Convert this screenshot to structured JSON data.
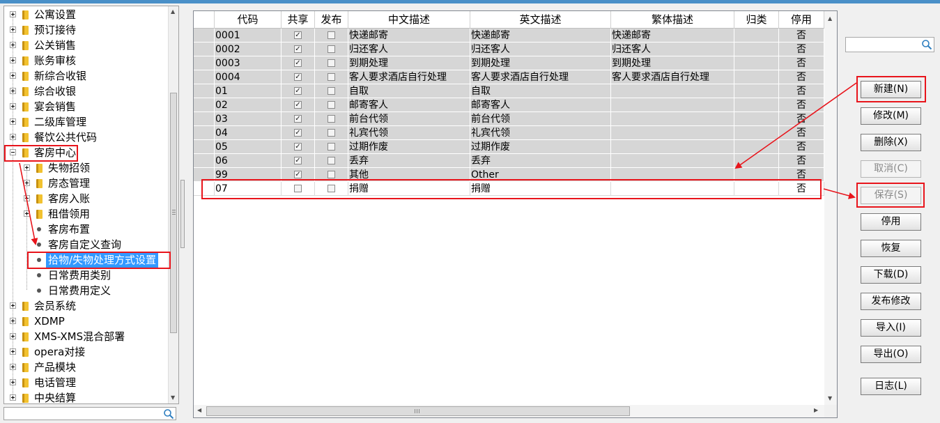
{
  "tree": {
    "items": [
      {
        "label": "公寓设置",
        "level": 0,
        "kind": "folder",
        "expander": "plus"
      },
      {
        "label": "预订接待",
        "level": 0,
        "kind": "folder",
        "expander": "plus"
      },
      {
        "label": "公关销售",
        "level": 0,
        "kind": "folder",
        "expander": "plus"
      },
      {
        "label": "账务审核",
        "level": 0,
        "kind": "folder",
        "expander": "plus"
      },
      {
        "label": "新综合收银",
        "level": 0,
        "kind": "folder",
        "expander": "plus"
      },
      {
        "label": "综合收银",
        "level": 0,
        "kind": "folder",
        "expander": "plus"
      },
      {
        "label": "宴会销售",
        "level": 0,
        "kind": "folder",
        "expander": "plus"
      },
      {
        "label": "二级库管理",
        "level": 0,
        "kind": "folder",
        "expander": "plus"
      },
      {
        "label": "餐饮公共代码",
        "level": 0,
        "kind": "folder",
        "expander": "plus"
      },
      {
        "label": "客房中心",
        "level": 0,
        "kind": "folder",
        "expander": "minus"
      },
      {
        "label": "失物招领",
        "level": 1,
        "kind": "folder",
        "expander": "plus"
      },
      {
        "label": "房态管理",
        "level": 1,
        "kind": "folder",
        "expander": "plus"
      },
      {
        "label": "客房入账",
        "level": 1,
        "kind": "folder",
        "expander": "plus"
      },
      {
        "label": "租借领用",
        "level": 1,
        "kind": "folder",
        "expander": "plus"
      },
      {
        "label": "客房布置",
        "level": 1,
        "kind": "leaf"
      },
      {
        "label": "客房自定义查询",
        "level": 1,
        "kind": "leaf"
      },
      {
        "label": "拾物/失物处理方式设置",
        "level": 1,
        "kind": "leaf",
        "selected": true
      },
      {
        "label": "日常费用类别",
        "level": 1,
        "kind": "leaf"
      },
      {
        "label": "日常费用定义",
        "level": 1,
        "kind": "leaf"
      },
      {
        "label": "会员系统",
        "level": 0,
        "kind": "folder",
        "expander": "plus"
      },
      {
        "label": "XDMP",
        "level": 0,
        "kind": "folder",
        "expander": "plus"
      },
      {
        "label": "XMS-XMS混合部署",
        "level": 0,
        "kind": "folder",
        "expander": "plus"
      },
      {
        "label": "opera对接",
        "level": 0,
        "kind": "folder",
        "expander": "plus"
      },
      {
        "label": "产品模块",
        "level": 0,
        "kind": "folder",
        "expander": "plus"
      },
      {
        "label": "电话管理",
        "level": 0,
        "kind": "folder",
        "expander": "plus"
      },
      {
        "label": "中央结算",
        "level": 0,
        "kind": "folder",
        "expander": "plus"
      }
    ],
    "search_value": ""
  },
  "grid": {
    "columns": [
      "代码",
      "共享",
      "发布",
      "中文描述",
      "英文描述",
      "繁体描述",
      "归类",
      "停用"
    ],
    "rows": [
      {
        "code": "0001",
        "shared": true,
        "published": false,
        "cn": "快递邮寄",
        "en": "快递邮寄",
        "tw": "快递邮寄",
        "category": "",
        "disabled": "否",
        "style": "grey"
      },
      {
        "code": "0002",
        "shared": true,
        "published": false,
        "cn": "归还客人",
        "en": "归还客人",
        "tw": "归还客人",
        "category": "",
        "disabled": "否",
        "style": "grey"
      },
      {
        "code": "0003",
        "shared": true,
        "published": false,
        "cn": "到期处理",
        "en": "到期处理",
        "tw": "到期处理",
        "category": "",
        "disabled": "否",
        "style": "grey"
      },
      {
        "code": "0004",
        "shared": true,
        "published": false,
        "cn": "客人要求酒店自行处理",
        "en": "客人要求酒店自行处理",
        "tw": "客人要求酒店自行处理",
        "category": "",
        "disabled": "否",
        "style": "grey"
      },
      {
        "code": "01",
        "shared": true,
        "published": false,
        "cn": "自取",
        "en": "自取",
        "tw": "",
        "category": "",
        "disabled": "否",
        "style": "grey"
      },
      {
        "code": "02",
        "shared": true,
        "published": false,
        "cn": "邮寄客人",
        "en": "邮寄客人",
        "tw": "",
        "category": "",
        "disabled": "否",
        "style": "grey"
      },
      {
        "code": "03",
        "shared": true,
        "published": false,
        "cn": "前台代领",
        "en": "前台代领",
        "tw": "",
        "category": "",
        "disabled": "否",
        "style": "grey"
      },
      {
        "code": "04",
        "shared": true,
        "published": false,
        "cn": "礼宾代领",
        "en": "礼宾代领",
        "tw": "",
        "category": "",
        "disabled": "否",
        "style": "grey"
      },
      {
        "code": "05",
        "shared": true,
        "published": false,
        "cn": "过期作废",
        "en": "过期作废",
        "tw": "",
        "category": "",
        "disabled": "否",
        "style": "grey"
      },
      {
        "code": "06",
        "shared": true,
        "published": false,
        "cn": "丢弃",
        "en": "丢弃",
        "tw": "",
        "category": "",
        "disabled": "否",
        "style": "grey"
      },
      {
        "code": "99",
        "shared": true,
        "published": false,
        "cn": "其他",
        "en": "Other",
        "tw": "",
        "category": "",
        "disabled": "否",
        "style": "grey"
      },
      {
        "code": "07",
        "shared": false,
        "published": false,
        "cn": "捐赠",
        "en": "捐赠",
        "tw": "",
        "category": "",
        "disabled": "否",
        "style": "white"
      }
    ]
  },
  "right": {
    "search_value": "",
    "buttons": [
      {
        "id": "new",
        "label": "新建(N)",
        "enabled": true,
        "highlight": true
      },
      {
        "id": "edit",
        "label": "修改(M)",
        "enabled": true
      },
      {
        "id": "delete",
        "label": "删除(X)",
        "enabled": true
      },
      {
        "id": "cancel",
        "label": "取消(C)",
        "enabled": false
      },
      {
        "id": "save",
        "label": "保存(S)",
        "enabled": false,
        "highlight": true
      },
      {
        "id": "disable",
        "label": "停用",
        "enabled": true
      },
      {
        "id": "restore",
        "label": "恢复",
        "enabled": true
      },
      {
        "id": "download",
        "label": "下载(D)",
        "enabled": true
      },
      {
        "id": "publish-edit",
        "label": "发布修改",
        "enabled": true
      },
      {
        "id": "import",
        "label": "导入(I)",
        "enabled": true
      },
      {
        "id": "export",
        "label": "导出(O)",
        "enabled": true
      },
      {
        "id": "log",
        "label": "日志(L)",
        "enabled": true
      }
    ]
  },
  "colors": {
    "annotation_red": "#e8141b",
    "selection_blue": "#3399ff",
    "row_grey": "#d6d6d6"
  },
  "icons": {
    "tree_folder": "folder-icon",
    "tree_leaf": "bullet-icon",
    "search": "search-icon"
  }
}
